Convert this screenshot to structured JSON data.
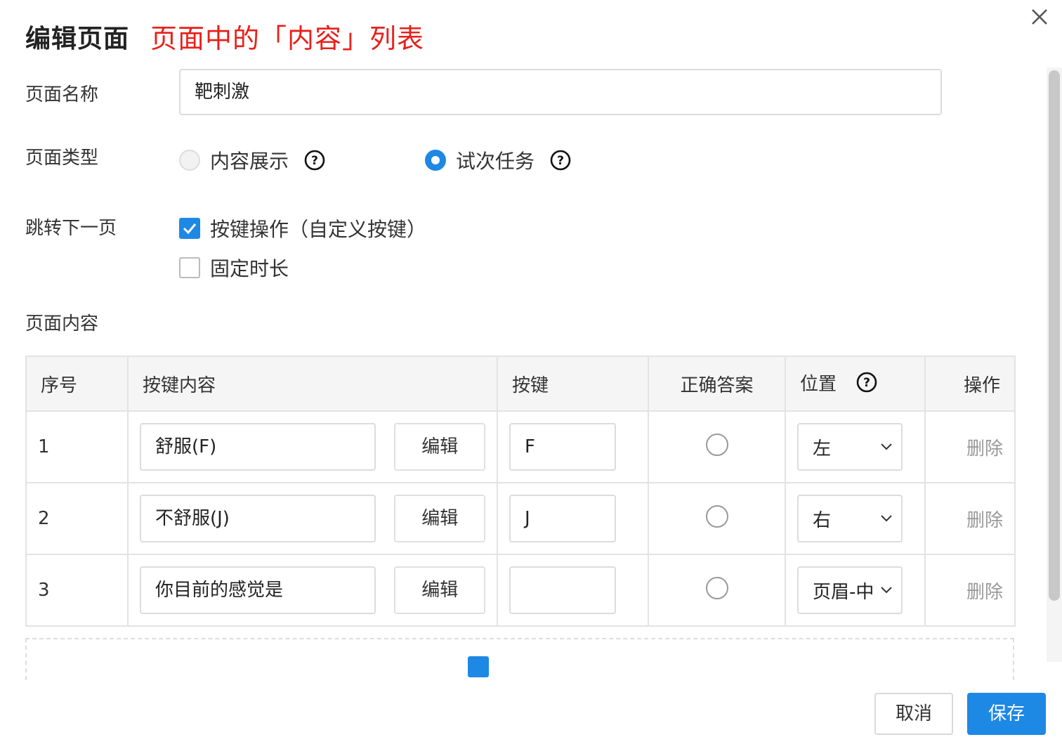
{
  "dialog": {
    "title": "编辑页面",
    "annotation": "页面中的「内容」列表",
    "close_icon": "close-icon"
  },
  "form": {
    "page_name": {
      "label": "页面名称",
      "value": "靶刺激"
    },
    "page_type": {
      "label": "页面类型",
      "options": [
        {
          "label": "内容展示",
          "checked": false
        },
        {
          "label": "试次任务",
          "checked": true
        }
      ]
    },
    "next_page": {
      "label": "跳转下一页",
      "options": [
        {
          "label": "按键操作（自定义按键）",
          "checked": true
        },
        {
          "label": "固定时长",
          "checked": false
        }
      ]
    },
    "page_content": {
      "label": "页面内容"
    }
  },
  "table": {
    "headers": [
      "序号",
      "按键内容",
      "按键",
      "正确答案",
      "位置",
      "操作"
    ],
    "rows": [
      {
        "index": "1",
        "content": "舒服(F)",
        "edit": "编辑",
        "key": "F",
        "position": "左",
        "action": "删除"
      },
      {
        "index": "2",
        "content": "不舒服(J)",
        "edit": "编辑",
        "key": "J",
        "position": "右",
        "action": "删除"
      },
      {
        "index": "3",
        "content": "你目前的感觉是",
        "edit": "编辑",
        "key": "",
        "position": "页眉-中",
        "action": "删除"
      }
    ]
  },
  "footer": {
    "cancel_label": "取消",
    "save_label": "保存"
  },
  "colors": {
    "accent": "#1e88e5",
    "annotation": "#e8201a"
  }
}
